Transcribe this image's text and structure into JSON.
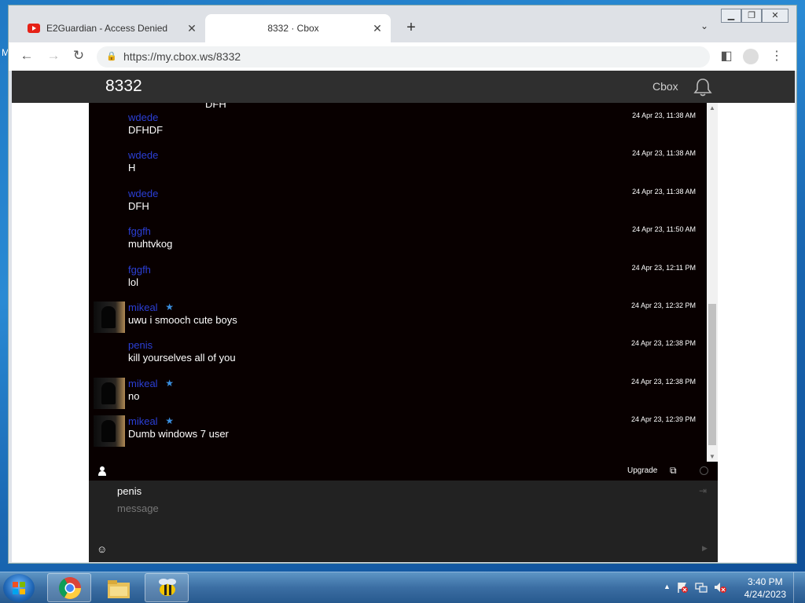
{
  "browser": {
    "tabs": [
      {
        "title": "E2Guardian - Access Denied",
        "icon": "youtube-icon",
        "active": false
      },
      {
        "title": "8332 · Cbox",
        "icon": null,
        "active": true
      }
    ],
    "new_tab": "+",
    "url": "https://my.cbox.ws/8332"
  },
  "desktop": {
    "edge_letter": "M"
  },
  "cbox": {
    "title": "8332",
    "header_link": "Cbox",
    "partial_top_text": "DFH",
    "messages": [
      {
        "name": "wdede",
        "star": false,
        "avatar": false,
        "text": "DFHDF",
        "time": "24 Apr 23, 11:38 AM"
      },
      {
        "name": "wdede",
        "star": false,
        "avatar": false,
        "text": "H",
        "time": "24 Apr 23, 11:38 AM"
      },
      {
        "name": "wdede",
        "star": false,
        "avatar": false,
        "text": "DFH",
        "time": "24 Apr 23, 11:38 AM"
      },
      {
        "name": "fggfh",
        "star": false,
        "avatar": false,
        "text": "muhtvkog",
        "time": "24 Apr 23, 11:50 AM"
      },
      {
        "name": "fggfh",
        "star": false,
        "avatar": false,
        "text": "lol",
        "time": "24 Apr 23, 12:11 PM"
      },
      {
        "name": "mikeal",
        "star": true,
        "avatar": true,
        "text": "uwu i smooch cute boys",
        "time": "24 Apr 23, 12:32 PM"
      },
      {
        "name": "penis",
        "star": false,
        "avatar": false,
        "text": "kill yourselves all of you",
        "time": "24 Apr 23, 12:38 PM"
      },
      {
        "name": "mikeal",
        "star": true,
        "avatar": true,
        "text": "no",
        "time": "24 Apr 23, 12:38 PM"
      },
      {
        "name": "mikeal",
        "star": true,
        "avatar": true,
        "text": "Dumb windows 7 user",
        "time": "24 Apr 23, 12:39 PM"
      }
    ],
    "upgrade_label": "Upgrade",
    "compose": {
      "nickname": "penis",
      "placeholder": "message"
    },
    "colors": {
      "name": "#2b3fd6",
      "chat_bg": "#080000",
      "header_bg": "#2f2f2f"
    }
  },
  "taskbar": {
    "pinned": [
      "chrome-icon",
      "file-explorer-icon",
      "bee-app-icon"
    ],
    "clock_time": "3:40 PM",
    "clock_date": "4/24/2023"
  }
}
